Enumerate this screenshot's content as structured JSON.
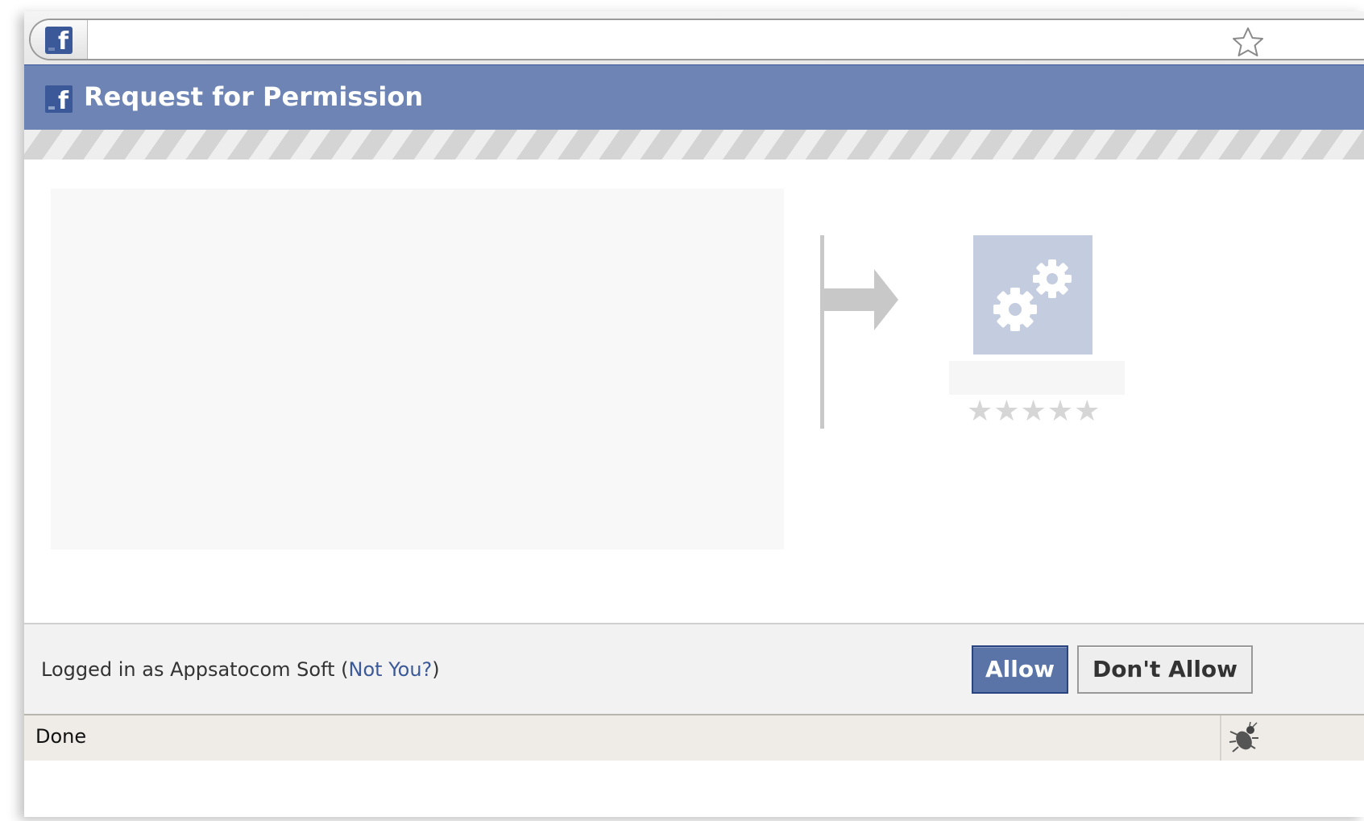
{
  "browser": {
    "url_value": "",
    "favicon_letter": "f"
  },
  "dialog": {
    "logo_letter": "f",
    "title": "Request for Permission"
  },
  "app": {
    "rating_stars": "★★★★★"
  },
  "footer": {
    "logged_in_prefix": "Logged in as Appsatocom Soft (",
    "not_you_link": "Not You?",
    "logged_in_suffix": ")",
    "allow_label": "Allow",
    "dont_allow_label": "Don't Allow"
  },
  "status_bar": {
    "status_text": "Done"
  },
  "colors": {
    "facebook_blue": "#3b5998",
    "header_blue": "#6d84b4",
    "allow_button": "#5b74a8",
    "app_icon_bg": "#c4cde0"
  },
  "icons": {
    "favicon": "facebook-icon",
    "bookmark": "star-outline-icon",
    "arrow": "arrow-right-icon",
    "app": "gears-icon",
    "status": "firebug-icon"
  }
}
